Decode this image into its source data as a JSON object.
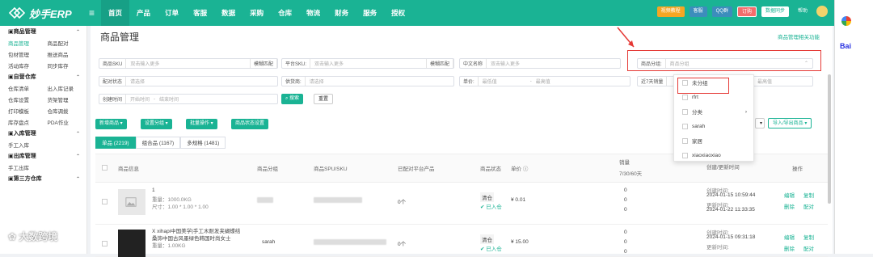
{
  "app": {
    "logo": "妙手ERP"
  },
  "nav": [
    "首页",
    "产品",
    "订单",
    "客服",
    "数据",
    "采购",
    "仓库",
    "物流",
    "财务",
    "服务",
    "授权"
  ],
  "top": {
    "video": "视频教程",
    "service": "客服",
    "qq": "QQ群",
    "order": "订购",
    "sync": "数据同步",
    "help": "帮助"
  },
  "sidebar": [
    {
      "group": "商品管理",
      "items": [
        [
          "商品管理",
          "商品配对"
        ],
        [
          "包材管理",
          "推送商品"
        ],
        [
          "活动库存",
          "同步库存"
        ]
      ]
    },
    {
      "group": "自营仓库",
      "items": [
        [
          "仓库清单",
          "出入库记录"
        ],
        [
          "仓库设置",
          "货架管理"
        ],
        [
          "打印模板",
          "仓库调拨"
        ],
        [
          "库存盘点",
          "PDA作业"
        ]
      ]
    },
    {
      "group": "入库管理",
      "items": [
        [
          "手工入库",
          ""
        ]
      ]
    },
    {
      "group": "出库管理",
      "items": [
        [
          "手工出库",
          ""
        ]
      ]
    },
    {
      "group": "第三方仓库",
      "items": []
    }
  ],
  "page": {
    "title": "商品管理",
    "help": "商品管理相关功能"
  },
  "filters": {
    "sku_label": "商品SKU",
    "sku_ph": "双击输入更多",
    "fuzzy1": "模糊匹配",
    "psku_label": "平台SKU:",
    "psku_ph": "双击输入更多",
    "fuzzy2": "模糊匹配",
    "cn_label": "中文名称",
    "cn_ph": "双击输入更多",
    "group_label": "商品分组:",
    "group_ph": "商品分组",
    "pair_label": "配对状态",
    "pair_ph": "请选择",
    "supplier_label": "供货商:",
    "supplier_ph": "请选择",
    "price_label": "单价:",
    "min": "最低值",
    "max": "最高值",
    "sales_label": "近7天销量",
    "max2": "最高值",
    "time_label": "创建时间",
    "start": "开始时间",
    "end": "结束时间",
    "search": "搜索",
    "reset": "重置"
  },
  "actions": {
    "add": "新增商品",
    "group": "设置分组",
    "batch": "批量操作",
    "status": "商品状态设置",
    "import": "导入/导出商品"
  },
  "tabs": [
    "单品 (2219)",
    "组合品 (1167)",
    "多规格 (1481)"
  ],
  "columns": {
    "info": "商品信息",
    "group": "商品分组",
    "spu": "商品SPU/SKU",
    "paired": "已配对平台产品",
    "state": "商品状态",
    "price": "单价",
    "sales": "销量",
    "sales2": "7/30/60天",
    "time": "创建/更新时间",
    "op": "操作"
  },
  "rows": [
    {
      "name": "1",
      "weight": "重量：1000.0KG",
      "size": "尺寸：1.00 * 1.00 * 1.00",
      "group": "",
      "paired": "0个",
      "state": "清仓",
      "instock": "已入仓",
      "price": "¥ 0.01",
      "s1": "0",
      "s2": "0",
      "s3": "0",
      "created_l": "创建时间:",
      "created": "2024-01-15 10:59:44",
      "updated_l": "更新时间:",
      "updated": "2024-01-22 11:33:35",
      "ops": [
        "编辑",
        "复制",
        "删除",
        "配对"
      ]
    },
    {
      "name": "X xihapi中国美学|手工木耐发夹蝴蝶结",
      "name2": "桑饰中国古风墨绿色韩国时尚女士",
      "weight": "重量：1.00KG",
      "group": "sarah",
      "paired": "0个",
      "state": "清仓",
      "instock": "已入仓",
      "price": "¥ 15.00",
      "s1": "0",
      "s2": "0",
      "s3": "0",
      "created_l": "创建时间:",
      "created": "2024-01-15 09:31:18",
      "updated_l": "更新时间:",
      "ops": [
        "编辑",
        "复制",
        "删除",
        "配对"
      ]
    }
  ],
  "dropdown": [
    "未分组",
    "rfrt",
    "分类",
    "sarah",
    "家居",
    "xiaoxiaoxiao"
  ],
  "watermark": "大数跨境"
}
